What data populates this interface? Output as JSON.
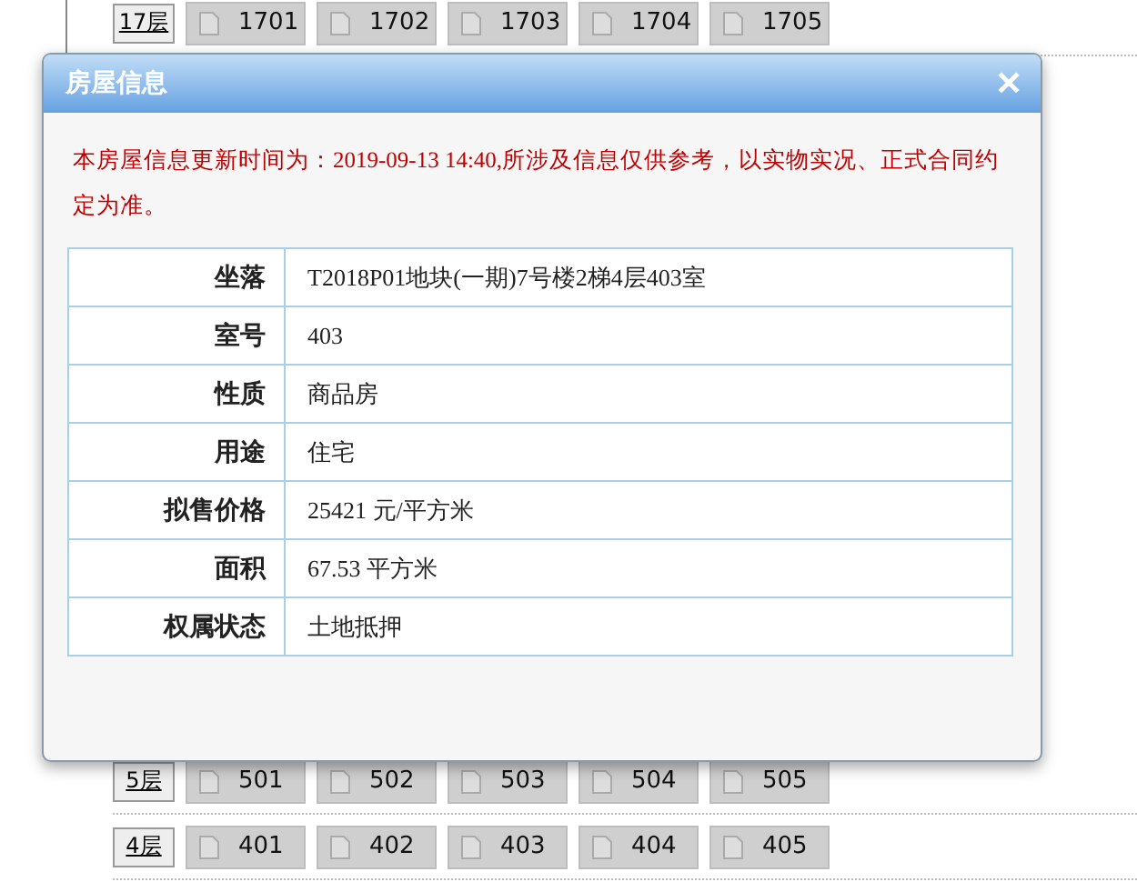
{
  "floors_top": [
    {
      "label": "17层",
      "units": [
        "1701",
        "1702",
        "1703",
        "1704",
        "1705"
      ]
    }
  ],
  "floors_bottom": [
    {
      "label": "5层",
      "units": [
        "501",
        "502",
        "503",
        "504",
        "505"
      ]
    },
    {
      "label": "4层",
      "units": [
        "401",
        "402",
        "403",
        "404",
        "405"
      ]
    }
  ],
  "dialog": {
    "title": "房屋信息",
    "close": "✕",
    "notice": "本房屋信息更新时间为：2019-09-13 14:40,所涉及信息仅供参考，以实物实况、正式合同约定为准。",
    "rows": [
      {
        "label": "坐落",
        "value": "T2018P01地块(一期)7号楼2梯4层403室"
      },
      {
        "label": "室号",
        "value": "403"
      },
      {
        "label": "性质",
        "value": "商品房"
      },
      {
        "label": "用途",
        "value": "住宅"
      },
      {
        "label": "拟售价格",
        "value": "25421 元/平方米"
      },
      {
        "label": "面积",
        "value": "67.53 平方米"
      },
      {
        "label": "权属状态",
        "value": "土地抵押"
      }
    ]
  }
}
